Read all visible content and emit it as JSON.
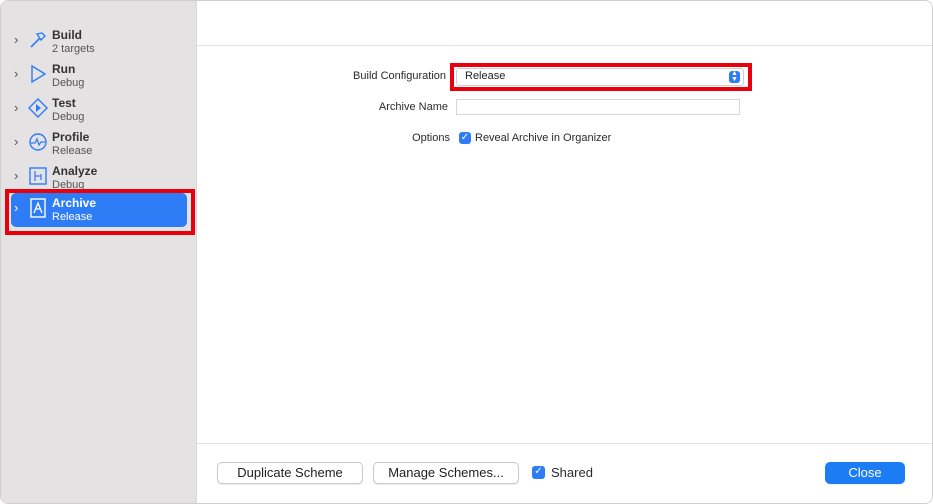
{
  "sidebar": {
    "items": [
      {
        "title": "Build",
        "subtitle": "2 targets",
        "icon": "hammer-icon"
      },
      {
        "title": "Run",
        "subtitle": "Debug",
        "icon": "play-icon"
      },
      {
        "title": "Test",
        "subtitle": "Debug",
        "icon": "test-diamond-icon"
      },
      {
        "title": "Profile",
        "subtitle": "Release",
        "icon": "gauge-icon"
      },
      {
        "title": "Analyze",
        "subtitle": "Debug",
        "icon": "analyze-icon"
      },
      {
        "title": "Archive",
        "subtitle": "Release",
        "icon": "archive-icon"
      }
    ],
    "selected": "Archive"
  },
  "form": {
    "build_configuration_label": "Build Configuration",
    "build_configuration_value": "Release",
    "archive_name_label": "Archive Name",
    "archive_name_value": "",
    "options_label": "Options",
    "reveal_archive_label": "Reveal Archive in Organizer",
    "reveal_archive_checked": true
  },
  "footer": {
    "duplicate_label": "Duplicate Scheme",
    "manage_label": "Manage Schemes...",
    "shared_label": "Shared",
    "shared_checked": true,
    "close_label": "Close"
  },
  "colors": {
    "accent": "#2e7cf6",
    "highlight": "#e8000d",
    "sidebar_bg": "#e4e2e3"
  }
}
